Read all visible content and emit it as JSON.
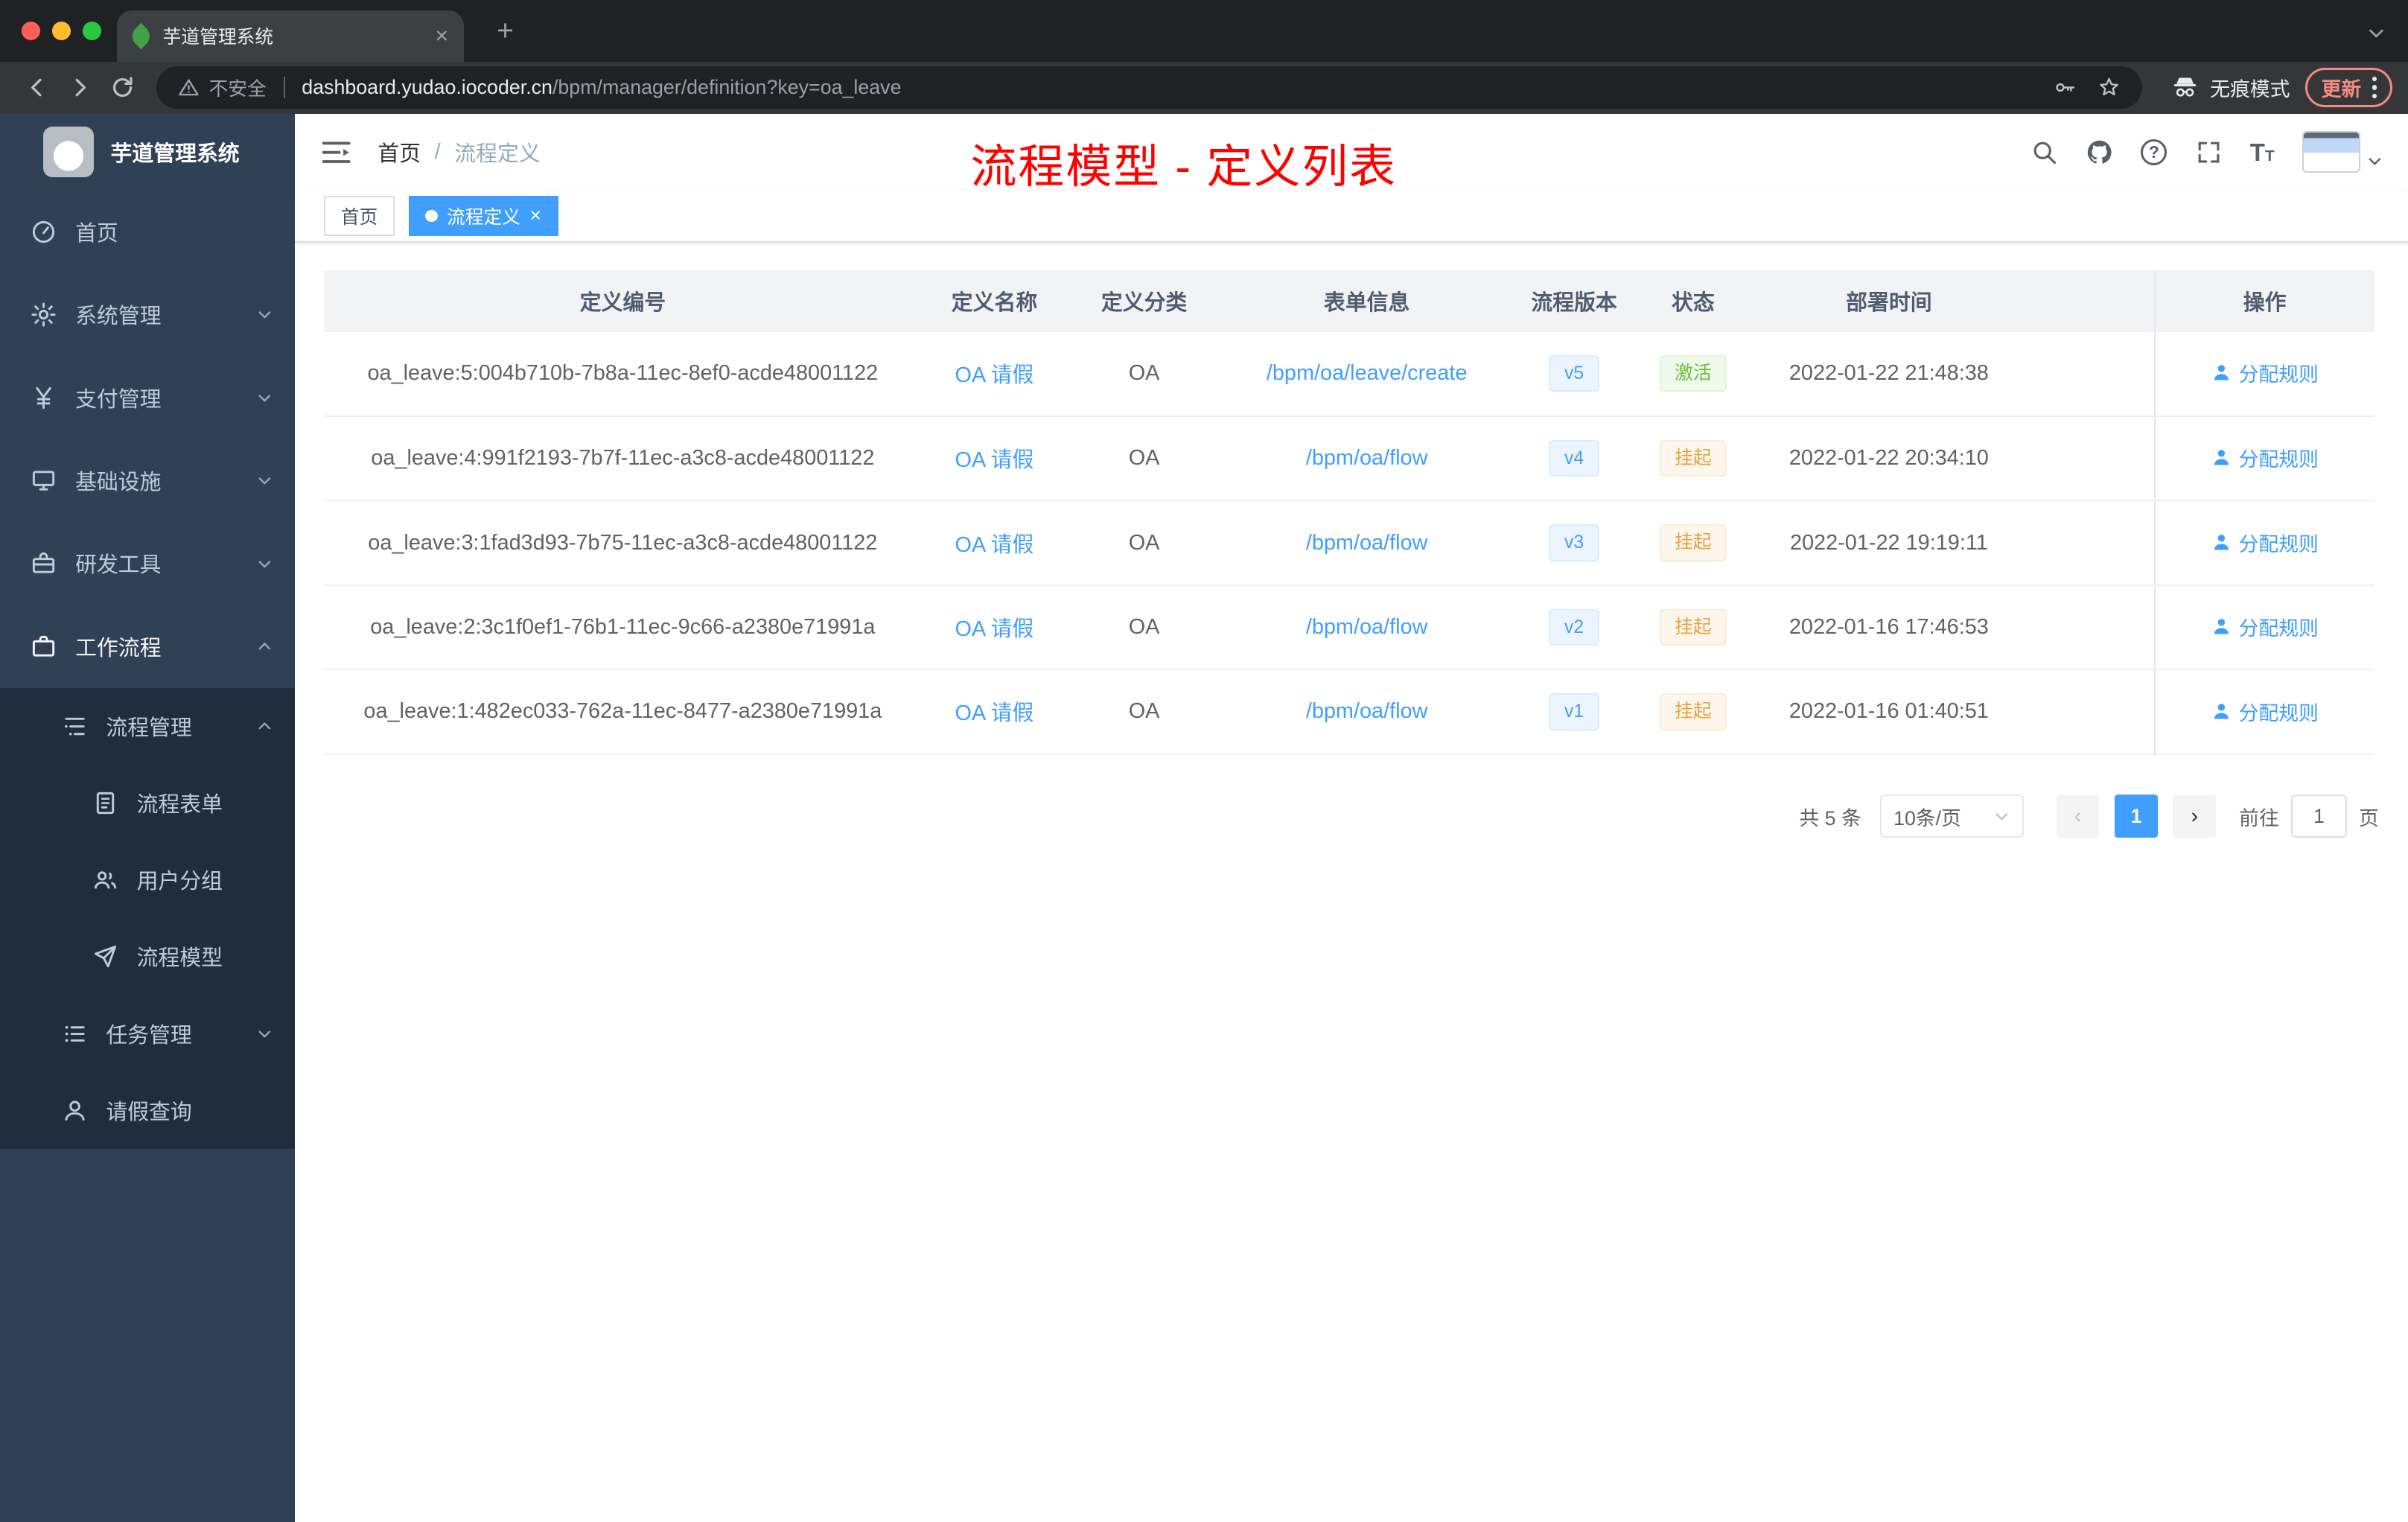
{
  "browser": {
    "tab": {
      "title": "芋道管理系统"
    },
    "address": {
      "security_label": "不安全",
      "host": "dashboard.yudao.iocoder.cn",
      "path": "/bpm/manager/definition?key=oa_leave"
    },
    "incognito_label": "无痕模式",
    "update_label": "更新"
  },
  "glyphs": {
    "close": "×",
    "plus": "+",
    "question": "?",
    "text_size": "T",
    "prev": "‹",
    "next": "›"
  },
  "sidebar": {
    "logo_title": "芋道管理系统",
    "items": [
      {
        "key": "home",
        "label": "首页",
        "icon": "dashboard-icon",
        "level": 1
      },
      {
        "key": "system",
        "label": "系统管理",
        "icon": "gear-icon",
        "level": 1,
        "chevron": "down"
      },
      {
        "key": "payment",
        "label": "支付管理",
        "icon": "yen-icon",
        "level": 1,
        "chevron": "down"
      },
      {
        "key": "infrastructure",
        "label": "基础设施",
        "icon": "monitor-icon",
        "level": 1,
        "chevron": "down"
      },
      {
        "key": "dev-tools",
        "label": "研发工具",
        "icon": "toolbox-icon",
        "level": 1,
        "chevron": "down"
      },
      {
        "key": "workflow",
        "label": "工作流程",
        "icon": "briefcase-icon",
        "level": 1,
        "chevron": "up",
        "active": true
      },
      {
        "key": "process-mgmt",
        "label": "流程管理",
        "icon": "tree-icon",
        "level": 2,
        "chevron": "up",
        "sub": true
      },
      {
        "key": "process-form",
        "label": "流程表单",
        "icon": "document-icon",
        "level": 3,
        "sub": true
      },
      {
        "key": "user-group",
        "label": "用户分组",
        "icon": "people-icon",
        "level": 3,
        "sub": true
      },
      {
        "key": "process-model",
        "label": "流程模型",
        "icon": "send-icon",
        "level": 3,
        "sub": true
      },
      {
        "key": "task-mgmt",
        "label": "任务管理",
        "icon": "list-icon",
        "level": 2,
        "chevron": "down",
        "sub": true
      },
      {
        "key": "leave-query",
        "label": "请假查询",
        "icon": "user-icon",
        "level": 2,
        "sub": true
      }
    ]
  },
  "header": {
    "breadcrumb_home": "首页",
    "breadcrumb_sep": "/",
    "breadcrumb_current": "流程定义",
    "annotation": "流程模型 - 定义列表"
  },
  "tags": [
    {
      "label": "首页",
      "active": false
    },
    {
      "label": "流程定义",
      "active": true
    }
  ],
  "table": {
    "columns": [
      "定义编号",
      "定义名称",
      "定义分类",
      "表单信息",
      "流程版本",
      "状态",
      "部署时间",
      "操作"
    ],
    "rows": [
      {
        "id": "oa_leave:5:004b710b-7b8a-11ec-8ef0-acde48001122",
        "name": "OA 请假",
        "category": "OA",
        "form": "/bpm/oa/leave/create",
        "version": "v5",
        "status": "激活",
        "status_type": "success",
        "deploy_time": "2022-01-22 21:48:38",
        "action": "分配规则"
      },
      {
        "id": "oa_leave:4:991f2193-7b7f-11ec-a3c8-acde48001122",
        "name": "OA 请假",
        "category": "OA",
        "form": "/bpm/oa/flow",
        "version": "v4",
        "status": "挂起",
        "status_type": "warning",
        "deploy_time": "2022-01-22 20:34:10",
        "action": "分配规则"
      },
      {
        "id": "oa_leave:3:1fad3d93-7b75-11ec-a3c8-acde48001122",
        "name": "OA 请假",
        "category": "OA",
        "form": "/bpm/oa/flow",
        "version": "v3",
        "status": "挂起",
        "status_type": "warning",
        "deploy_time": "2022-01-22 19:19:11",
        "action": "分配规则"
      },
      {
        "id": "oa_leave:2:3c1f0ef1-76b1-11ec-9c66-a2380e71991a",
        "name": "OA 请假",
        "category": "OA",
        "form": "/bpm/oa/flow",
        "version": "v2",
        "status": "挂起",
        "status_type": "warning",
        "deploy_time": "2022-01-16 17:46:53",
        "action": "分配规则"
      },
      {
        "id": "oa_leave:1:482ec033-762a-11ec-8477-a2380e71991a",
        "name": "OA 请假",
        "category": "OA",
        "form": "/bpm/oa/flow",
        "version": "v1",
        "status": "挂起",
        "status_type": "warning",
        "deploy_time": "2022-01-16 01:40:51",
        "action": "分配规则"
      }
    ]
  },
  "pagination": {
    "total": "共 5 条",
    "page_size": "10条/页",
    "current_page": "1",
    "goto_label": "前往",
    "goto_value": "1",
    "page_unit": "页"
  },
  "colors": {
    "accent": "#409eff",
    "success": "#67c23a",
    "warning": "#e6a23c",
    "annotation_red": "#fe0000",
    "sidebar_bg": "#304156",
    "submenu_bg": "#1f2d3d",
    "update_orange": "#f28b82"
  }
}
